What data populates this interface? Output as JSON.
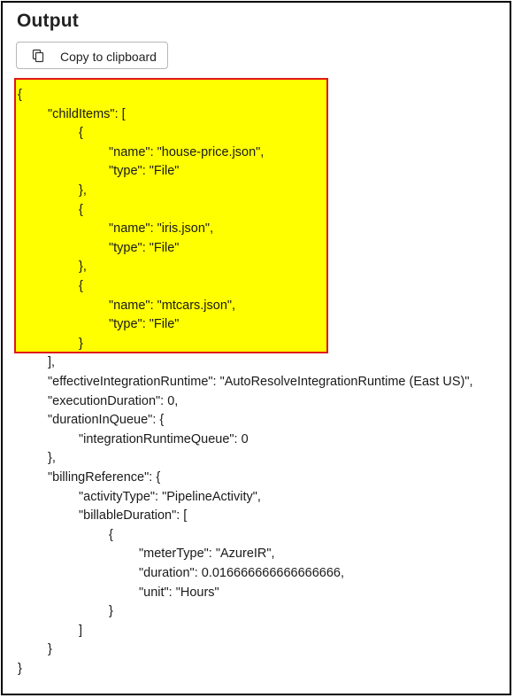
{
  "panel": {
    "title": "Output",
    "copy_button_label": "Copy to clipboard",
    "copy_icon": "copy-icon",
    "highlight_colors": {
      "fill": "#ffff00",
      "border": "#e01818"
    }
  },
  "json_output": {
    "lines": [
      "{",
      "\"childItems\": [",
      "{",
      "\"name\": \"house-price.json\",",
      "\"type\": \"File\"",
      "},",
      "{",
      "\"name\": \"iris.json\",",
      "\"type\": \"File\"",
      "},",
      "{",
      "\"name\": \"mtcars.json\",",
      "\"type\": \"File\"",
      "}",
      "],",
      "\"effectiveIntegrationRuntime\": \"AutoResolveIntegrationRuntime (East US)\",",
      "\"executionDuration\": 0,",
      "\"durationInQueue\": {",
      "\"integrationRuntimeQueue\": 0",
      "},",
      "\"billingReference\": {",
      "\"activityType\": \"PipelineActivity\",",
      "\"billableDuration\": [",
      "{",
      "\"meterType\": \"AzureIR\",",
      "\"duration\": 0.016666666666666666,",
      "\"unit\": \"Hours\"",
      "}",
      "]",
      "}",
      "}"
    ]
  }
}
